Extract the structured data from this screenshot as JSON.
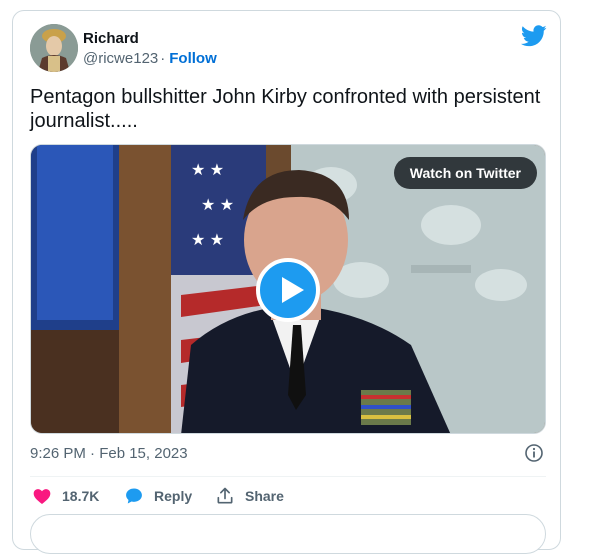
{
  "author": {
    "name": "Richard",
    "handle": "@ricwe123",
    "separator": "·",
    "follow_label": "Follow"
  },
  "tweet": {
    "text": "Pentagon bullshitter John Kirby confronted with persistent journalist.....",
    "timestamp": "9:26 PM · Feb 15, 2023"
  },
  "media": {
    "watch_label": "Watch on Twitter",
    "play_icon": "play-icon"
  },
  "actions": {
    "like_count": "18.7K",
    "reply_label": "Reply",
    "share_label": "Share"
  },
  "colors": {
    "twitter_blue": "#1d9bf0",
    "follow_link": "#006fd6",
    "like_pink": "#f91880",
    "secondary_text": "#536471",
    "border": "#cfd9de"
  },
  "icons": [
    "twitter-bird-icon",
    "info-icon",
    "heart-icon",
    "reply-bubble-icon",
    "share-icon"
  ]
}
